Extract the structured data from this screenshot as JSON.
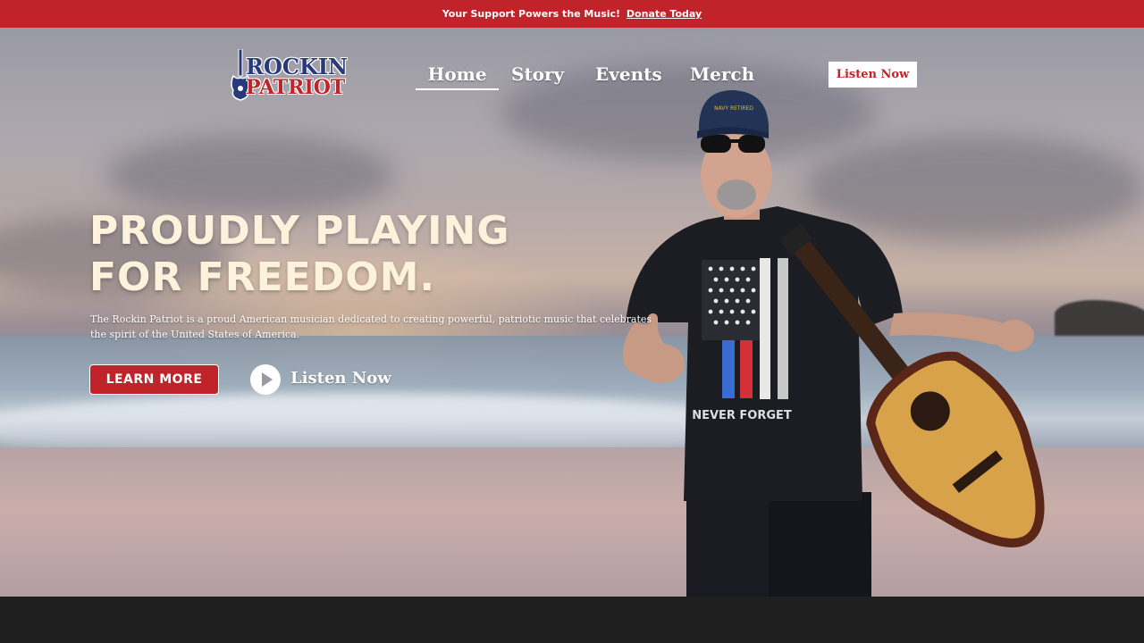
{
  "announcement": {
    "text": "Your Support Powers the Music!",
    "link_label": "Donate Today"
  },
  "logo": {
    "line1": "ROCKIN",
    "line2": "PATRIOT"
  },
  "nav": {
    "items": [
      {
        "label": "Home"
      },
      {
        "label": "Story"
      },
      {
        "label": "Events"
      },
      {
        "label": "Merch"
      }
    ],
    "cta_label": "Listen Now"
  },
  "hero": {
    "headline_line1": "PROUDLY PLAYING",
    "headline_line2": "FOR FREEDOM.",
    "tagline": "The Rockin Patriot is a proud American musician dedicated to creating powerful, patriotic music that celebrates the spirit of the United States of America.",
    "primary_button": "LEARN MORE",
    "secondary_link": "Listen Now",
    "shirt_text": "NEVER FORGET",
    "cap_text": "NAVY RETIRED"
  },
  "colors": {
    "accent": "#c0232a",
    "navy": "#283a7a",
    "headline": "#fdf3dc",
    "footer": "#1f1f1f"
  }
}
